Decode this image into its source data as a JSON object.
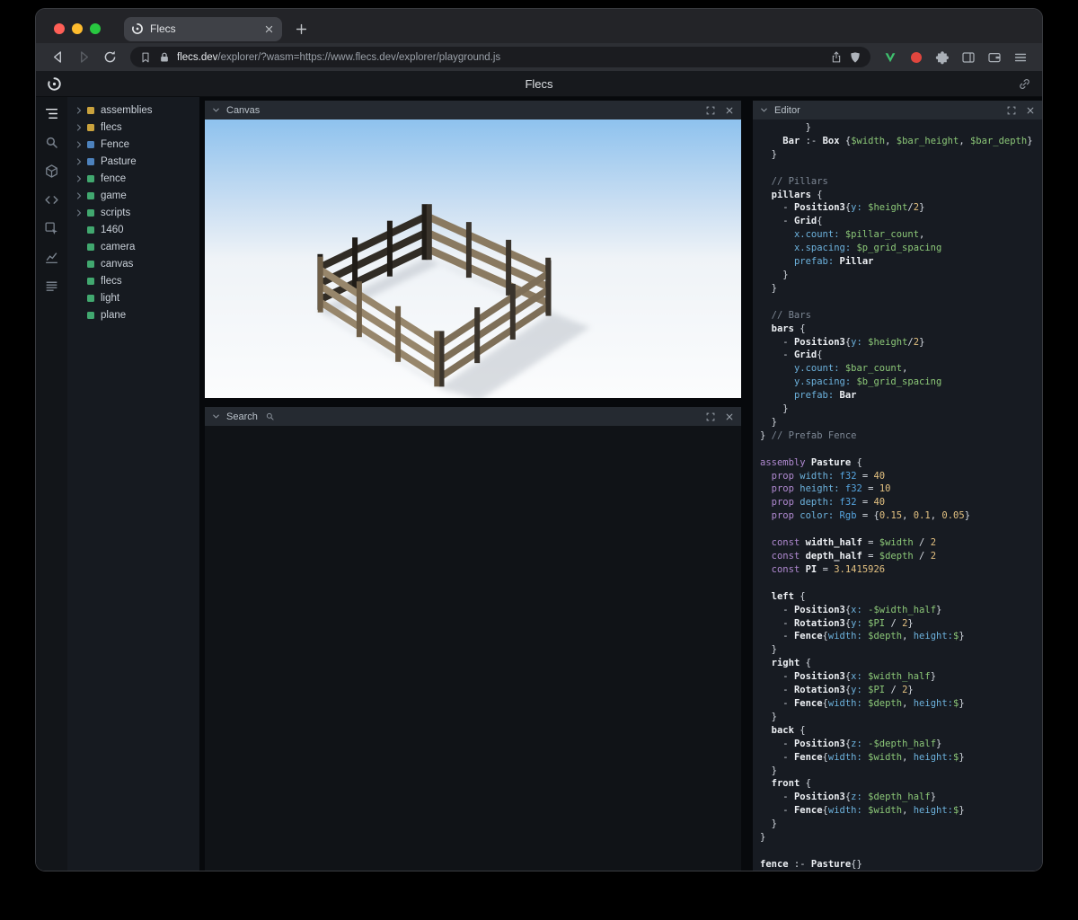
{
  "browser": {
    "tab_title": "Flecs",
    "url_domain": "flecs.dev",
    "url_path": "/explorer/?wasm=https://www.flecs.dev/explorer/playground.js"
  },
  "app": {
    "title": "Flecs"
  },
  "sidebar": {
    "items": [
      {
        "icon": "tree",
        "active": true
      },
      {
        "icon": "search",
        "active": false
      },
      {
        "icon": "cube",
        "active": false
      },
      {
        "icon": "code",
        "active": false
      },
      {
        "icon": "inspect",
        "active": false
      },
      {
        "icon": "chart",
        "active": false
      },
      {
        "icon": "stack",
        "active": false
      }
    ]
  },
  "tree": {
    "items": [
      {
        "label": "assemblies",
        "color": "#c9a23d",
        "expandable": true
      },
      {
        "label": "flecs",
        "color": "#c9a23d",
        "expandable": true
      },
      {
        "label": "Fence",
        "color": "#4d82bd",
        "expandable": true
      },
      {
        "label": "Pasture",
        "color": "#4d82bd",
        "expandable": true
      },
      {
        "label": "fence",
        "color": "#41a86f",
        "expandable": true
      },
      {
        "label": "game",
        "color": "#41a86f",
        "expandable": true
      },
      {
        "label": "scripts",
        "color": "#41a86f",
        "expandable": true
      },
      {
        "label": "1460",
        "color": "#41a86f",
        "expandable": false
      },
      {
        "label": "camera",
        "color": "#41a86f",
        "expandable": false
      },
      {
        "label": "canvas",
        "color": "#41a86f",
        "expandable": false
      },
      {
        "label": "flecs",
        "color": "#41a86f",
        "expandable": false
      },
      {
        "label": "light",
        "color": "#41a86f",
        "expandable": false
      },
      {
        "label": "plane",
        "color": "#41a86f",
        "expandable": false
      }
    ]
  },
  "panels": {
    "canvas": {
      "title": "Canvas"
    },
    "search": {
      "title": "Search"
    },
    "editor": {
      "title": "Editor"
    }
  },
  "scene": {
    "sky_top": "#8ec2ee",
    "sky_low": "#c9def2",
    "horizon": "#eff3f7",
    "ground": "#fbfcfd",
    "shadow": "#b8bec6",
    "wood_light": "#97866b",
    "wood_mid": "#8a7a61",
    "wood_mid2": "#7e6f58",
    "wood_dark": "#312c25",
    "wood_darkest": "#201c17",
    "post_dark": "#3a342c",
    "post_brown": "#6f5f48"
  },
  "editor_code": {
    "lines": [
      [
        [
          "p",
          "        }"
        ]
      ],
      [
        [
          "p",
          "    "
        ],
        [
          "i",
          "Bar"
        ],
        [
          "p",
          " :- "
        ],
        [
          "i",
          "Box"
        ],
        [
          "p",
          " {"
        ],
        [
          "v",
          "$width"
        ],
        [
          "p",
          ", "
        ],
        [
          "v",
          "$bar_height"
        ],
        [
          "p",
          ", "
        ],
        [
          "v",
          "$bar_depth"
        ],
        [
          "p",
          "}"
        ]
      ],
      [
        [
          "p",
          "  }"
        ]
      ],
      [],
      [
        [
          "c",
          "  // Pillars"
        ]
      ],
      [
        [
          "p",
          "  "
        ],
        [
          "i",
          "pillars"
        ],
        [
          "p",
          " {"
        ]
      ],
      [
        [
          "p",
          "    - "
        ],
        [
          "i",
          "Position3"
        ],
        [
          "p",
          "{"
        ],
        [
          "key",
          "y:"
        ],
        [
          "p",
          " "
        ],
        [
          "v",
          "$height"
        ],
        [
          "p",
          "/"
        ],
        [
          "n",
          "2"
        ],
        [
          "p",
          "}"
        ]
      ],
      [
        [
          "p",
          "    - "
        ],
        [
          "i",
          "Grid"
        ],
        [
          "p",
          "{"
        ]
      ],
      [
        [
          "p",
          "      "
        ],
        [
          "key",
          "x.count:"
        ],
        [
          "p",
          " "
        ],
        [
          "v",
          "$pillar_count"
        ],
        [
          "p",
          ","
        ]
      ],
      [
        [
          "p",
          "      "
        ],
        [
          "key",
          "x.spacing:"
        ],
        [
          "p",
          " "
        ],
        [
          "v",
          "$p_grid_spacing"
        ]
      ],
      [
        [
          "p",
          "      "
        ],
        [
          "key",
          "prefab:"
        ],
        [
          "p",
          " "
        ],
        [
          "i",
          "Pillar"
        ]
      ],
      [
        [
          "p",
          "    }"
        ]
      ],
      [
        [
          "p",
          "  }"
        ]
      ],
      [],
      [
        [
          "c",
          "  // Bars"
        ]
      ],
      [
        [
          "p",
          "  "
        ],
        [
          "i",
          "bars"
        ],
        [
          "p",
          " {"
        ]
      ],
      [
        [
          "p",
          "    - "
        ],
        [
          "i",
          "Position3"
        ],
        [
          "p",
          "{"
        ],
        [
          "key",
          "y:"
        ],
        [
          "p",
          " "
        ],
        [
          "v",
          "$height"
        ],
        [
          "p",
          "/"
        ],
        [
          "n",
          "2"
        ],
        [
          "p",
          "}"
        ]
      ],
      [
        [
          "p",
          "    - "
        ],
        [
          "i",
          "Grid"
        ],
        [
          "p",
          "{"
        ]
      ],
      [
        [
          "p",
          "      "
        ],
        [
          "key",
          "y.count:"
        ],
        [
          "p",
          " "
        ],
        [
          "v",
          "$bar_count"
        ],
        [
          "p",
          ","
        ]
      ],
      [
        [
          "p",
          "      "
        ],
        [
          "key",
          "y.spacing:"
        ],
        [
          "p",
          " "
        ],
        [
          "v",
          "$b_grid_spacing"
        ]
      ],
      [
        [
          "p",
          "      "
        ],
        [
          "key",
          "prefab:"
        ],
        [
          "p",
          " "
        ],
        [
          "i",
          "Bar"
        ]
      ],
      [
        [
          "p",
          "    }"
        ]
      ],
      [
        [
          "p",
          "  }"
        ]
      ],
      [
        [
          "p",
          "} "
        ],
        [
          "c",
          "// Prefab Fence"
        ]
      ],
      [],
      [
        [
          "k",
          "assembly"
        ],
        [
          "p",
          " "
        ],
        [
          "i",
          "Pasture"
        ],
        [
          "p",
          " {"
        ]
      ],
      [
        [
          "p",
          "  "
        ],
        [
          "k",
          "prop"
        ],
        [
          "p",
          " "
        ],
        [
          "key",
          "width:"
        ],
        [
          "p",
          " "
        ],
        [
          "t",
          "f32"
        ],
        [
          "p",
          " = "
        ],
        [
          "n",
          "40"
        ]
      ],
      [
        [
          "p",
          "  "
        ],
        [
          "k",
          "prop"
        ],
        [
          "p",
          " "
        ],
        [
          "key",
          "height:"
        ],
        [
          "p",
          " "
        ],
        [
          "t",
          "f32"
        ],
        [
          "p",
          " = "
        ],
        [
          "n",
          "10"
        ]
      ],
      [
        [
          "p",
          "  "
        ],
        [
          "k",
          "prop"
        ],
        [
          "p",
          " "
        ],
        [
          "key",
          "depth:"
        ],
        [
          "p",
          " "
        ],
        [
          "t",
          "f32"
        ],
        [
          "p",
          " = "
        ],
        [
          "n",
          "40"
        ]
      ],
      [
        [
          "p",
          "  "
        ],
        [
          "k",
          "prop"
        ],
        [
          "p",
          " "
        ],
        [
          "key",
          "color:"
        ],
        [
          "p",
          " "
        ],
        [
          "t",
          "Rgb"
        ],
        [
          "p",
          " = {"
        ],
        [
          "n",
          "0.15"
        ],
        [
          "p",
          ", "
        ],
        [
          "n",
          "0.1"
        ],
        [
          "p",
          ", "
        ],
        [
          "n",
          "0.05"
        ],
        [
          "p",
          "}"
        ]
      ],
      [],
      [
        [
          "p",
          "  "
        ],
        [
          "k",
          "const"
        ],
        [
          "p",
          " "
        ],
        [
          "i",
          "width_half"
        ],
        [
          "p",
          " = "
        ],
        [
          "v",
          "$width"
        ],
        [
          "p",
          " / "
        ],
        [
          "n",
          "2"
        ]
      ],
      [
        [
          "p",
          "  "
        ],
        [
          "k",
          "const"
        ],
        [
          "p",
          " "
        ],
        [
          "i",
          "depth_half"
        ],
        [
          "p",
          " = "
        ],
        [
          "v",
          "$depth"
        ],
        [
          "p",
          " / "
        ],
        [
          "n",
          "2"
        ]
      ],
      [
        [
          "p",
          "  "
        ],
        [
          "k",
          "const"
        ],
        [
          "p",
          " "
        ],
        [
          "i",
          "PI"
        ],
        [
          "p",
          " = "
        ],
        [
          "n",
          "3.1415926"
        ]
      ],
      [],
      [
        [
          "p",
          "  "
        ],
        [
          "i",
          "left"
        ],
        [
          "p",
          " {"
        ]
      ],
      [
        [
          "p",
          "    - "
        ],
        [
          "i",
          "Position3"
        ],
        [
          "p",
          "{"
        ],
        [
          "key",
          "x:"
        ],
        [
          "p",
          " "
        ],
        [
          "v",
          "-$width_half"
        ],
        [
          "p",
          "}"
        ]
      ],
      [
        [
          "p",
          "    - "
        ],
        [
          "i",
          "Rotation3"
        ],
        [
          "p",
          "{"
        ],
        [
          "key",
          "y:"
        ],
        [
          "p",
          " "
        ],
        [
          "v",
          "$PI"
        ],
        [
          "p",
          " / "
        ],
        [
          "n",
          "2"
        ],
        [
          "p",
          "}"
        ]
      ],
      [
        [
          "p",
          "    - "
        ],
        [
          "i",
          "Fence"
        ],
        [
          "p",
          "{"
        ],
        [
          "key",
          "width:"
        ],
        [
          "p",
          " "
        ],
        [
          "v",
          "$depth"
        ],
        [
          "p",
          ", "
        ],
        [
          "key",
          "height:"
        ],
        [
          "v",
          "$"
        ],
        [
          "p",
          "}"
        ]
      ],
      [
        [
          "p",
          "  }"
        ]
      ],
      [
        [
          "p",
          "  "
        ],
        [
          "i",
          "right"
        ],
        [
          "p",
          " {"
        ]
      ],
      [
        [
          "p",
          "    - "
        ],
        [
          "i",
          "Position3"
        ],
        [
          "p",
          "{"
        ],
        [
          "key",
          "x:"
        ],
        [
          "p",
          " "
        ],
        [
          "v",
          "$width_half"
        ],
        [
          "p",
          "}"
        ]
      ],
      [
        [
          "p",
          "    - "
        ],
        [
          "i",
          "Rotation3"
        ],
        [
          "p",
          "{"
        ],
        [
          "key",
          "y:"
        ],
        [
          "p",
          " "
        ],
        [
          "v",
          "$PI"
        ],
        [
          "p",
          " / "
        ],
        [
          "n",
          "2"
        ],
        [
          "p",
          "}"
        ]
      ],
      [
        [
          "p",
          "    - "
        ],
        [
          "i",
          "Fence"
        ],
        [
          "p",
          "{"
        ],
        [
          "key",
          "width:"
        ],
        [
          "p",
          " "
        ],
        [
          "v",
          "$depth"
        ],
        [
          "p",
          ", "
        ],
        [
          "key",
          "height:"
        ],
        [
          "v",
          "$"
        ],
        [
          "p",
          "}"
        ]
      ],
      [
        [
          "p",
          "  }"
        ]
      ],
      [
        [
          "p",
          "  "
        ],
        [
          "i",
          "back"
        ],
        [
          "p",
          " {"
        ]
      ],
      [
        [
          "p",
          "    - "
        ],
        [
          "i",
          "Position3"
        ],
        [
          "p",
          "{"
        ],
        [
          "key",
          "z:"
        ],
        [
          "p",
          " "
        ],
        [
          "v",
          "-$depth_half"
        ],
        [
          "p",
          "}"
        ]
      ],
      [
        [
          "p",
          "    - "
        ],
        [
          "i",
          "Fence"
        ],
        [
          "p",
          "{"
        ],
        [
          "key",
          "width:"
        ],
        [
          "p",
          " "
        ],
        [
          "v",
          "$width"
        ],
        [
          "p",
          ", "
        ],
        [
          "key",
          "height:"
        ],
        [
          "v",
          "$"
        ],
        [
          "p",
          "}"
        ]
      ],
      [
        [
          "p",
          "  }"
        ]
      ],
      [
        [
          "p",
          "  "
        ],
        [
          "i",
          "front"
        ],
        [
          "p",
          " {"
        ]
      ],
      [
        [
          "p",
          "    - "
        ],
        [
          "i",
          "Position3"
        ],
        [
          "p",
          "{"
        ],
        [
          "key",
          "z:"
        ],
        [
          "p",
          " "
        ],
        [
          "v",
          "$depth_half"
        ],
        [
          "p",
          "}"
        ]
      ],
      [
        [
          "p",
          "    - "
        ],
        [
          "i",
          "Fence"
        ],
        [
          "p",
          "{"
        ],
        [
          "key",
          "width:"
        ],
        [
          "p",
          " "
        ],
        [
          "v",
          "$width"
        ],
        [
          "p",
          ", "
        ],
        [
          "key",
          "height:"
        ],
        [
          "v",
          "$"
        ],
        [
          "p",
          "}"
        ]
      ],
      [
        [
          "p",
          "  }"
        ]
      ],
      [
        [
          "p",
          "}"
        ]
      ],
      [],
      [
        [
          "i",
          "fence"
        ],
        [
          "p",
          " :- "
        ],
        [
          "i",
          "Pasture"
        ],
        [
          "p",
          "{}"
        ]
      ]
    ]
  }
}
